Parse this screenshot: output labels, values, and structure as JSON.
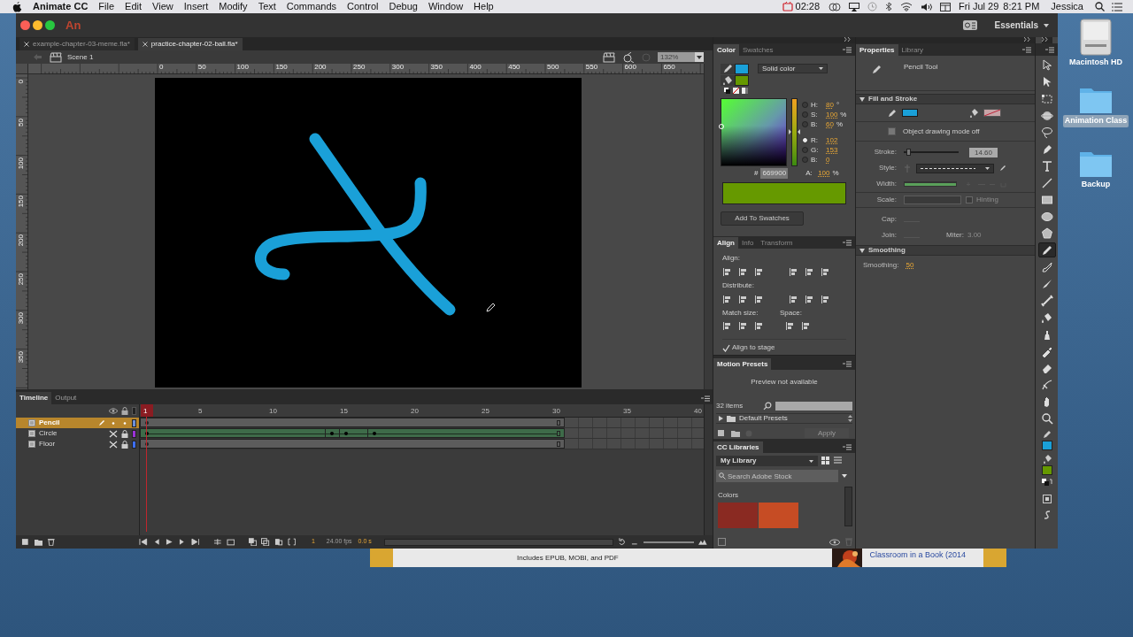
{
  "menu_bar": {
    "app_name": "Animate CC",
    "items": [
      "File",
      "Edit",
      "View",
      "Insert",
      "Modify",
      "Text",
      "Commands",
      "Control",
      "Debug",
      "Window",
      "Help"
    ],
    "timer": "02:28",
    "date": "Fri Jul 29",
    "time": "8:21 PM",
    "user": "Jessica"
  },
  "desktop_icons": [
    {
      "label": "Macintosh HD",
      "kind": "drive",
      "selected": false
    },
    {
      "label": "Animation Class",
      "kind": "folder",
      "selected": true
    },
    {
      "label": "Backup",
      "kind": "folder",
      "selected": false
    }
  ],
  "background_window": {
    "description": "Includes EPUB, MOBI, and PDF",
    "link": "Classroom in a Book (2014"
  },
  "window": {
    "logo": "An",
    "workspace": "Essentials"
  },
  "document_tabs": [
    {
      "label": "example-chapter-03-meme.fla*",
      "selected": false
    },
    {
      "label": "practice-chapter-02-ball.fla*",
      "selected": true
    }
  ],
  "scene": {
    "label": "Scene 1",
    "zoom": "132%"
  },
  "rulers": {
    "horizontal": [
      "0",
      "50",
      "100",
      "150",
      "200",
      "250",
      "300",
      "350",
      "400",
      "450",
      "500",
      "550",
      "600",
      "650"
    ],
    "vertical": [
      "0",
      "50",
      "100",
      "150",
      "200",
      "250",
      "300",
      "350"
    ]
  },
  "timeline": {
    "tabs": [
      {
        "label": "Timeline",
        "selected": true
      },
      {
        "label": "Output",
        "selected": false
      }
    ],
    "frame_numbers": [
      "1",
      "5",
      "10",
      "15",
      "20",
      "25",
      "30",
      "35",
      "40"
    ],
    "layers": [
      {
        "name": "Pencil",
        "selected": true,
        "visible": true,
        "locked": false,
        "tween": false,
        "color": "#6d8fd6"
      },
      {
        "name": "Circle",
        "selected": false,
        "visible": false,
        "locked": true,
        "tween": true,
        "color": "#9a32d6"
      },
      {
        "name": "Floor",
        "selected": false,
        "visible": false,
        "locked": true,
        "tween": false,
        "color": "#3d6ef2"
      }
    ],
    "current_frame": "1",
    "fps": "24.00 fps",
    "elapsed": "0.0 s"
  },
  "color_panel": {
    "tabs": [
      {
        "label": "Color",
        "selected": true
      },
      {
        "label": "Swatches",
        "selected": false
      }
    ],
    "fill_type": "Solid color",
    "brightness_slider": {
      "level": 0.5
    },
    "channels": [
      {
        "label": "H:",
        "value": "80",
        "unit": "°",
        "selected": false
      },
      {
        "label": "S:",
        "value": "100",
        "unit": "%",
        "selected": false
      },
      {
        "label": "B:",
        "value": "60",
        "unit": "%",
        "selected": false
      },
      {
        "label": "R:",
        "value": "102",
        "selected": true
      },
      {
        "label": "G:",
        "value": "153",
        "selected": false
      },
      {
        "label": "B:",
        "value": "0",
        "selected": false
      }
    ],
    "alpha": {
      "label": "A:",
      "value": "100",
      "unit": "%"
    },
    "hex_label": "#",
    "hex": "669900",
    "add_button": "Add To Swatches"
  },
  "align_panel": {
    "tabs": [
      {
        "label": "Align",
        "selected": true
      },
      {
        "label": "Info",
        "selected": false
      },
      {
        "label": "Transform",
        "selected": false
      }
    ],
    "align_label": "Align:",
    "distribute_label": "Distribute:",
    "match_size_label": "Match size:",
    "space_label": "Space:",
    "align_to_stage": {
      "label": "Align to stage",
      "checked": true
    }
  },
  "motion_presets": {
    "title": "Motion Presets",
    "preview": "Preview not available",
    "count": "32 items",
    "folder": "Default Presets",
    "apply_button": "Apply"
  },
  "cc_libraries": {
    "title": "CC Libraries",
    "library": "My Library",
    "search_placeholder": "Search Adobe Stock",
    "section": "Colors",
    "swatches": [
      {
        "color": "#8a2a22"
      },
      {
        "color": "#c64c24"
      }
    ]
  },
  "properties": {
    "tabs": [
      {
        "label": "Properties",
        "selected": true
      },
      {
        "label": "Library",
        "selected": false
      }
    ],
    "tool_name": "Pencil Tool",
    "fill_and_stroke": {
      "title": "Fill and Stroke",
      "expanded": true,
      "fill_none": true,
      "drawing_mode": "Object drawing mode off",
      "stroke": {
        "label": "Stroke:",
        "value": "14.60",
        "level": 0.06
      },
      "style_label": "Style:",
      "width_label": "Width:",
      "scale_label": "Scale:",
      "hinting": {
        "label": "Hinting",
        "checked": false,
        "disabled": true
      },
      "cap_label": "Cap:",
      "join_label": "Join:",
      "miter": {
        "label": "Miter:",
        "value": "3.00"
      }
    },
    "smoothing": {
      "title": "Smoothing",
      "expanded": true,
      "label": "Smoothing:",
      "value": "50"
    }
  },
  "tools": [
    {
      "kind": "selection",
      "selected": false
    },
    {
      "kind": "subselection",
      "selected": false
    },
    {
      "kind": "transform",
      "selected": false
    },
    {
      "kind": "rotate3d",
      "selected": false
    },
    {
      "kind": "lasso",
      "selected": false
    },
    {
      "kind": "pen",
      "selected": false
    },
    {
      "kind": "text",
      "selected": false
    },
    {
      "kind": "line",
      "selected": false
    },
    {
      "kind": "rectangle",
      "selected": false
    },
    {
      "kind": "oval",
      "selected": false
    },
    {
      "kind": "polystar",
      "selected": false
    },
    {
      "kind": "pencil",
      "selected": true
    },
    {
      "kind": "paintbrush",
      "selected": false
    },
    {
      "kind": "brush",
      "selected": false
    },
    {
      "kind": "bone",
      "selected": false
    },
    {
      "kind": "bucket",
      "selected": false
    },
    {
      "kind": "inkbottle",
      "selected": false
    },
    {
      "kind": "eyedropper",
      "selected": false
    },
    {
      "kind": "eraser",
      "selected": false
    },
    {
      "kind": "width",
      "selected": false
    },
    {
      "kind": "hand",
      "selected": false
    },
    {
      "kind": "zoom",
      "selected": false
    }
  ]
}
